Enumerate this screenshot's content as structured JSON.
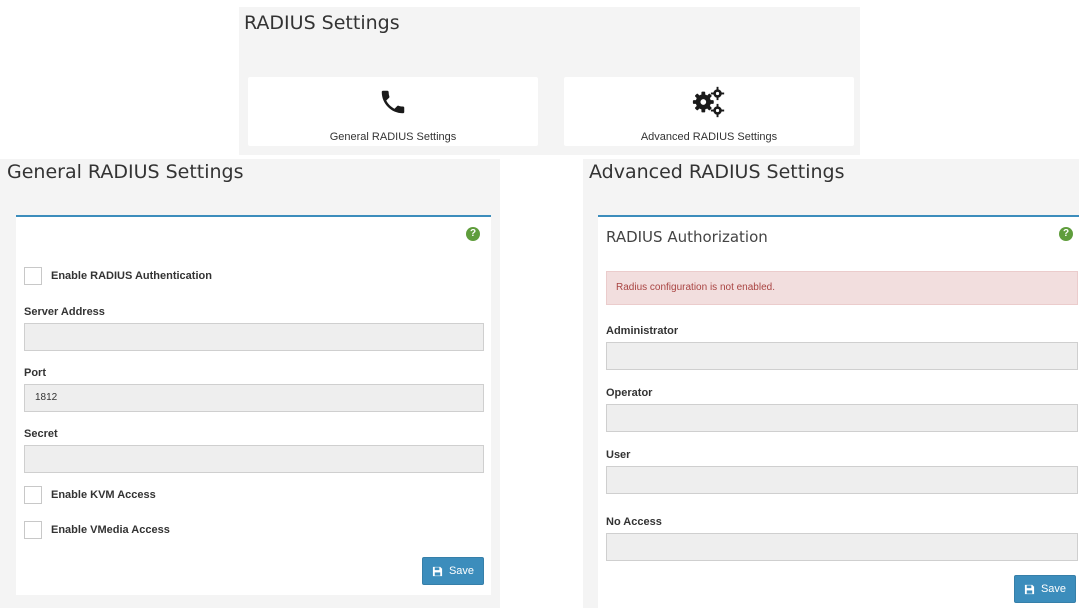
{
  "top": {
    "title": "RADIUS Settings",
    "tiles": [
      {
        "label": "General RADIUS Settings",
        "icon": "phone-icon"
      },
      {
        "label": "Advanced RADIUS Settings",
        "icon": "gears-icon"
      }
    ]
  },
  "general": {
    "title": "General RADIUS Settings",
    "enable_auth_label": "Enable RADIUS Authentication",
    "server_address_label": "Server Address",
    "server_address_value": "",
    "port_label": "Port",
    "port_value": "1812",
    "secret_label": "Secret",
    "secret_value": "",
    "enable_kvm_label": "Enable KVM Access",
    "enable_vmedia_label": "Enable VMedia Access",
    "save_label": "Save",
    "help_glyph": "?"
  },
  "advanced": {
    "title": "Advanced RADIUS Settings",
    "box_title": "RADIUS Authorization",
    "alert_text": "Radius configuration is not enabled.",
    "administrator_label": "Administrator",
    "operator_label": "Operator",
    "user_label": "User",
    "no_access_label": "No Access",
    "save_label": "Save",
    "help_glyph": "?"
  },
  "colors": {
    "accent": "#3c8dbc",
    "help": "#5f9d3c",
    "alert_bg": "#f2dede",
    "alert_text": "#a94442"
  }
}
